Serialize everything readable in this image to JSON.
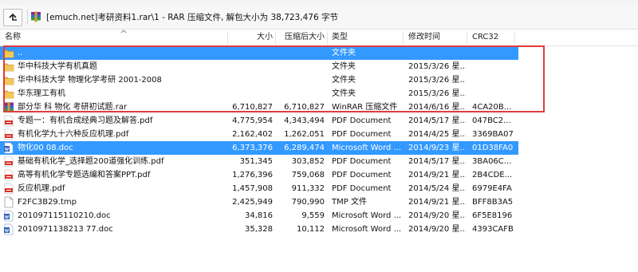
{
  "path": {
    "text": "[emuch.net]考研资料1.rar\\1 - RAR 压缩文件, 解包大小为 38,723,476 字节"
  },
  "columns": {
    "name": "名称",
    "size": "大小",
    "packed": "压缩后大小",
    "type": "类型",
    "modified": "修改时间",
    "crc": "CRC32"
  },
  "rows": [
    {
      "name": "..",
      "size": "",
      "packed": "",
      "type": "文件夹",
      "modified": "",
      "crc": "",
      "icon": "folder-up-icon",
      "selected": true
    },
    {
      "name": "华中科技大学有机真题",
      "size": "",
      "packed": "",
      "type": "文件夹",
      "modified": "2015/3/26 星...",
      "crc": "",
      "icon": "folder-icon",
      "selected": false
    },
    {
      "name": "华中科技大学 物理化学考研 2001-2008",
      "size": "",
      "packed": "",
      "type": "文件夹",
      "modified": "2015/3/26 星...",
      "crc": "",
      "icon": "folder-icon",
      "selected": false
    },
    {
      "name": "华东理工有机",
      "size": "",
      "packed": "",
      "type": "文件夹",
      "modified": "2015/3/26 星...",
      "crc": "",
      "icon": "folder-icon",
      "selected": false
    },
    {
      "name": "部分华 科 物化 考研初试题.rar",
      "size": "6,710,827",
      "packed": "6,710,827",
      "type": "WinRAR 压缩文件",
      "modified": "2014/6/16 星...",
      "crc": "4CA20B...",
      "icon": "rar-icon",
      "selected": false
    },
    {
      "name": "专题一：有机合成经典习题及解答.pdf",
      "size": "4,775,954",
      "packed": "4,343,494",
      "type": "PDF Document",
      "modified": "2014/5/17 星...",
      "crc": "047BC2...",
      "icon": "pdf-icon",
      "selected": false
    },
    {
      "name": "有机化学九十六种反应机理.pdf",
      "size": "2,162,402",
      "packed": "1,262,051",
      "type": "PDF Document",
      "modified": "2014/4/25 星...",
      "crc": "3369BA07",
      "icon": "pdf-icon",
      "selected": false
    },
    {
      "name": "物化00 08.doc",
      "size": "6,373,376",
      "packed": "6,289,474",
      "type": "Microsoft Word ...",
      "modified": "2014/9/23 星...",
      "crc": "01D38FA0",
      "icon": "doc-icon",
      "selected": true
    },
    {
      "name": "基础有机化学_选择题200道强化训练.pdf",
      "size": "351,345",
      "packed": "303,852",
      "type": "PDF Document",
      "modified": "2014/5/17 星...",
      "crc": "3BA06C...",
      "icon": "pdf-icon",
      "selected": false
    },
    {
      "name": "高等有机化学专题选编和答案PPT.pdf",
      "size": "1,276,396",
      "packed": "759,068",
      "type": "PDF Document",
      "modified": "2014/9/21 星...",
      "crc": "2B4CDE...",
      "icon": "pdf-icon",
      "selected": false
    },
    {
      "name": "反应机理.pdf",
      "size": "1,457,908",
      "packed": "911,332",
      "type": "PDF Document",
      "modified": "2014/5/24 星...",
      "crc": "6979E4FA",
      "icon": "pdf-icon",
      "selected": false
    },
    {
      "name": "F2FC3B29.tmp",
      "size": "2,425,949",
      "packed": "790,990",
      "type": "TMP 文件",
      "modified": "2014/9/21 星...",
      "crc": "BFF8B3A5",
      "icon": "tmp-icon",
      "selected": false
    },
    {
      "name": "201097115110210.doc",
      "size": "34,816",
      "packed": "9,559",
      "type": "Microsoft Word ...",
      "modified": "2014/9/20 星...",
      "crc": "6F5E8196",
      "icon": "doc-icon",
      "selected": false
    },
    {
      "name": "2010971138213 77.doc",
      "size": "35,328",
      "packed": "10,112",
      "type": "Microsoft Word ...",
      "modified": "2014/9/20 星...",
      "crc": "4393CAFB",
      "icon": "doc-icon",
      "selected": false
    }
  ]
}
